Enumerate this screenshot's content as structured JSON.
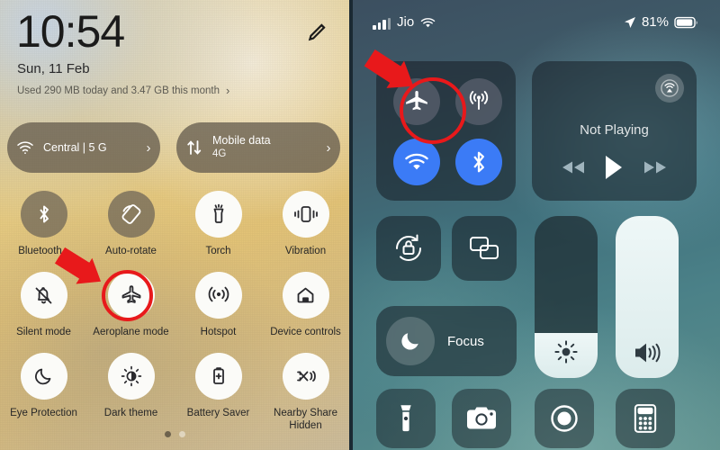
{
  "android": {
    "clock": "10:54",
    "date": "Sun, 11 Feb",
    "usage": "Used 290 MB today and 3.47 GB this month",
    "usage_chevron": "›",
    "edit_icon": "pencil-icon",
    "pills": [
      {
        "icon": "wifi-icon",
        "title": "Central | 5 G",
        "subtitle": "",
        "chevron": "›",
        "state": "on"
      },
      {
        "icon": "data-transfer-icon",
        "title": "Mobile data",
        "subtitle": "4G",
        "chevron": "›",
        "state": "on"
      }
    ],
    "tiles": [
      {
        "label": "Bluetooth",
        "sub": "",
        "icon": "bluetooth-icon",
        "state": "off",
        "chevron": "›"
      },
      {
        "label": "Auto-rotate",
        "sub": "",
        "icon": "auto-rotate-icon",
        "state": "off",
        "chevron": ""
      },
      {
        "label": "Torch",
        "sub": "",
        "icon": "torch-icon",
        "state": "on",
        "chevron": ""
      },
      {
        "label": "Vibration",
        "sub": "",
        "icon": "vibration-icon",
        "state": "on",
        "chevron": ""
      },
      {
        "label": "Silent mode",
        "sub": "",
        "icon": "bell-off-icon",
        "state": "on",
        "chevron": ""
      },
      {
        "label": "Aeroplane mode",
        "sub": "",
        "icon": "aeroplane-icon",
        "state": "on",
        "chevron": ""
      },
      {
        "label": "Hotspot",
        "sub": "",
        "icon": "hotspot-icon",
        "state": "on",
        "chevron": ""
      },
      {
        "label": "Device controls",
        "sub": "",
        "icon": "home-icon",
        "state": "on",
        "chevron": ""
      },
      {
        "label": "Eye Protection",
        "sub": "",
        "icon": "moon-icon",
        "state": "on",
        "chevron": ""
      },
      {
        "label": "Dark theme",
        "sub": "",
        "icon": "brightness-contrast-icon",
        "state": "on",
        "chevron": ""
      },
      {
        "label": "Battery Saver",
        "sub": "",
        "icon": "battery-plus-icon",
        "state": "on",
        "chevron": ""
      },
      {
        "label": "Nearby Share",
        "sub": "Hidden",
        "icon": "nearby-share-icon",
        "state": "on",
        "chevron": ""
      }
    ],
    "page_dots": {
      "count": 2,
      "active_index": 0
    },
    "colors": {
      "tile_off": "#675d4f",
      "tile_on": "#fbfbf8",
      "text": "#272727"
    }
  },
  "ios": {
    "status": {
      "signal_icon": "cellular-bars-icon",
      "carrier": "Jio",
      "wifi_icon": "wifi-icon",
      "location_icon": "location-arrow-icon",
      "battery_percent": "81%",
      "battery_icon": "battery-icon"
    },
    "connectivity": [
      {
        "name": "airplane-mode-button",
        "icon": "airplane-icon",
        "state": "off"
      },
      {
        "name": "cellular-data-button",
        "icon": "cellular-tower-icon",
        "state": "off"
      },
      {
        "name": "wifi-button",
        "icon": "wifi-icon",
        "state": "on"
      },
      {
        "name": "bluetooth-button",
        "icon": "bluetooth-icon",
        "state": "on"
      }
    ],
    "media": {
      "airplay_icon": "airplay-audio-icon",
      "status_text": "Not Playing",
      "rewind_icon": "rewind-icon",
      "play_icon": "play-icon",
      "forward_icon": "fast-forward-icon"
    },
    "rotation_lock_icon": "rotation-lock-icon",
    "screen_mirror_icon": "screen-mirroring-icon",
    "focus": {
      "label": "Focus",
      "icon": "moon-icon"
    },
    "sliders": [
      {
        "name": "brightness-slider",
        "icon": "brightness-icon",
        "value": 28
      },
      {
        "name": "volume-slider",
        "icon": "volume-icon",
        "value": 100
      }
    ],
    "shortcuts": [
      {
        "name": "flashlight-button",
        "icon": "flashlight-icon"
      },
      {
        "name": "camera-button",
        "icon": "camera-icon"
      },
      {
        "name": "screen-record-button",
        "icon": "screen-record-icon"
      },
      {
        "name": "calculator-button",
        "icon": "calculator-icon"
      }
    ],
    "colors": {
      "active": "#3b7bf6",
      "inactive": "#5c6370"
    }
  },
  "annotations": {
    "highlight_color": "#e8191b",
    "android_target": "Aeroplane mode",
    "ios_target": "Airplane Mode"
  }
}
